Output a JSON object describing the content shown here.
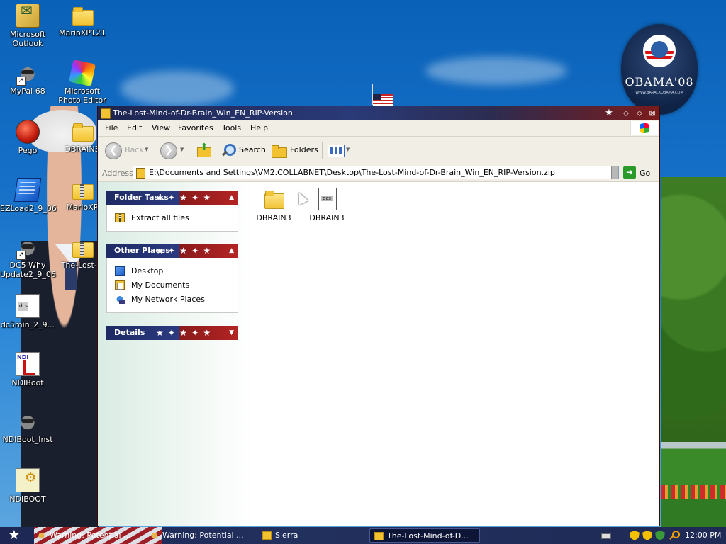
{
  "desktop": {
    "icons": [
      {
        "label": "Microsoft Outlook",
        "icon": "outlook-icon"
      },
      {
        "label": "MarioXP121",
        "icon": "folder-icon"
      },
      {
        "label": "MyPal 68",
        "icon": "raccoon-icon"
      },
      {
        "label": "Microsoft Photo Editor",
        "icon": "photo-editor-icon"
      },
      {
        "label": "Pego",
        "icon": "pego-icon"
      },
      {
        "label": "DBRAIN3",
        "icon": "folder-icon"
      },
      {
        "label": "EZLoad2_9_06",
        "icon": "ezload-icon"
      },
      {
        "label": "MarioXP",
        "icon": "zip-folder-icon"
      },
      {
        "label": "DC5 Why Update2_9_06",
        "icon": "raccoon-icon"
      },
      {
        "label": "The-Lost-M",
        "icon": "zip-folder-icon"
      },
      {
        "label": "dc5min_2_9...",
        "icon": "dcs-file-icon"
      },
      {
        "label": "NDIBoot",
        "icon": "ndi-icon"
      },
      {
        "label": "NDIBoot_Inst",
        "icon": "raccoon-icon"
      },
      {
        "label": "NDIBOOT",
        "icon": "notepad-gear-icon"
      }
    ],
    "wallpaper_badge": {
      "text": "OBAMA'08",
      "subtext": "WWW.BARACKOBAMA.COM"
    }
  },
  "window": {
    "title": "The-Lost-Mind-of-Dr-Brain_Win_EN_RIP-Version",
    "title_buttons": [
      "★",
      "⬦",
      "⬦",
      "⊠"
    ],
    "menu": [
      "File",
      "Edit",
      "View",
      "Favorites",
      "Tools",
      "Help"
    ],
    "toolbar": {
      "back_label": "Back",
      "search_label": "Search",
      "folders_label": "Folders"
    },
    "address": {
      "label": "Address",
      "value": "E:\\Documents and Settings\\VM2.COLLABNET\\Desktop\\The-Lost-Mind-of-Dr-Brain_Win_EN_RIP-Version.zip",
      "go_label": "Go"
    },
    "panes": {
      "folder_tasks": {
        "title": "Folder Tasks",
        "items": [
          "Extract all files"
        ]
      },
      "other_places": {
        "title": "Other Places",
        "items": [
          "Desktop",
          "My Documents",
          "My Network Places"
        ]
      },
      "details": {
        "title": "Details"
      }
    },
    "files": [
      {
        "name": "DBRAIN3",
        "icon": "folder-icon"
      },
      {
        "name": "DBRAIN3",
        "icon": "dcs-file-icon"
      }
    ]
  },
  "taskbar": {
    "start_label": "★",
    "buttons": [
      {
        "label": "Warning: Potential ...",
        "icon": "warning-icon"
      },
      {
        "label": "Warning: Potential ...",
        "icon": "warning-icon"
      },
      {
        "label": "Sierra",
        "icon": "folder-icon"
      },
      {
        "label": "The-Lost-Mind-of-D...",
        "icon": "zip-folder-icon"
      }
    ],
    "clock": "12:00 PM"
  },
  "colors": {
    "titlebar_left": "#1d2550",
    "titlebar_right": "#7a1b1b",
    "desktop_sky": "#1670c7",
    "taskbar": "#1e2754"
  }
}
